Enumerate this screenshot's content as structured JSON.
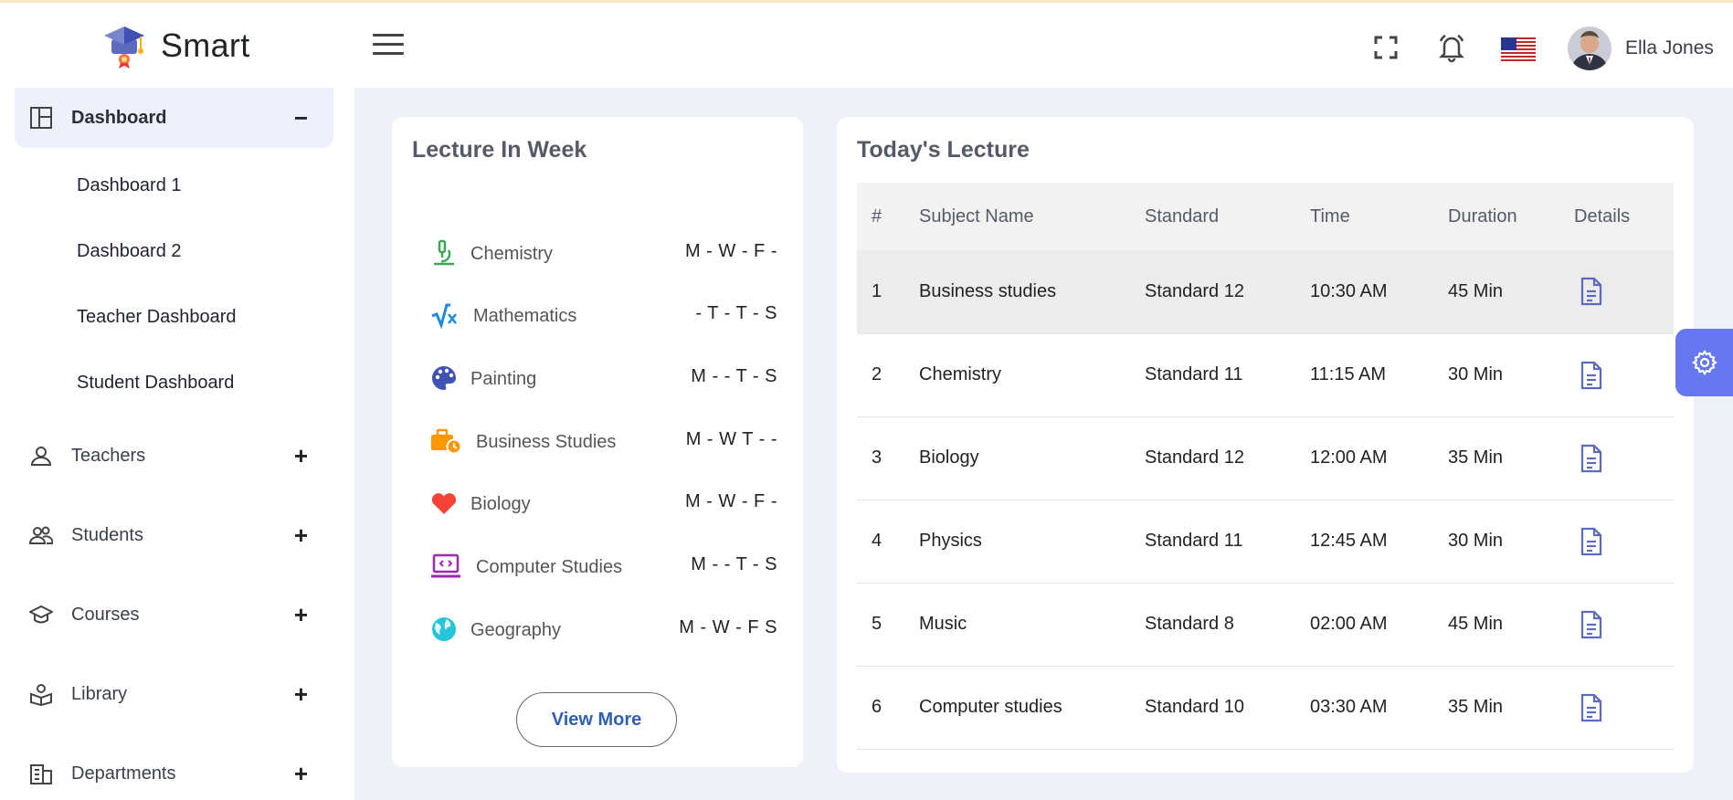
{
  "brand": {
    "name": "Smart"
  },
  "header": {
    "user_name": "Ella Jones"
  },
  "sidebar": {
    "dashboard": {
      "label": "Dashboard",
      "toggle": "−"
    },
    "dashboard_sub": [
      "Dashboard 1",
      "Dashboard 2",
      "Teacher Dashboard",
      "Student Dashboard"
    ],
    "items": [
      {
        "label": "Teachers",
        "toggle": "+"
      },
      {
        "label": "Students",
        "toggle": "+"
      },
      {
        "label": "Courses",
        "toggle": "+"
      },
      {
        "label": "Library",
        "toggle": "+"
      },
      {
        "label": "Departments",
        "toggle": "+"
      }
    ]
  },
  "week": {
    "title": "Lecture In Week",
    "rows": [
      {
        "subject": "Chemistry",
        "days": "M - W - F -",
        "icon": "microscope-icon",
        "color": "#3aa757"
      },
      {
        "subject": "Mathematics",
        "days": "- T - T - S",
        "icon": "square-root-icon",
        "color": "#1e88e5"
      },
      {
        "subject": "Painting",
        "days": "M - - T - S",
        "icon": "palette-icon",
        "color": "#3f51b5"
      },
      {
        "subject": "Business Studies",
        "days": "M - W T - -",
        "icon": "briefcase-clock-icon",
        "color": "#ff9800"
      },
      {
        "subject": "Biology",
        "days": "M - W - F -",
        "icon": "heart-icon",
        "color": "#f44336"
      },
      {
        "subject": "Computer Studies",
        "days": "M - - T - S",
        "icon": "laptop-code-icon",
        "color": "#9c27b0"
      },
      {
        "subject": "Geography",
        "days": "M - W - F S",
        "icon": "globe-icon",
        "color": "#26c6da"
      }
    ],
    "view_more": "View More"
  },
  "today": {
    "title": "Today's Lecture",
    "columns": [
      "#",
      "Subject Name",
      "Standard",
      "Time",
      "Duration",
      "Details"
    ],
    "rows": [
      {
        "no": "1",
        "subject": "Business studies",
        "standard": "Standard 12",
        "time": "10:30 AM",
        "duration": "45 Min"
      },
      {
        "no": "2",
        "subject": "Chemistry",
        "standard": "Standard 11",
        "time": "11:15 AM",
        "duration": "30 Min"
      },
      {
        "no": "3",
        "subject": "Biology",
        "standard": "Standard 12",
        "time": "12:00 AM",
        "duration": "35 Min"
      },
      {
        "no": "4",
        "subject": "Physics",
        "standard": "Standard 11",
        "time": "12:45 AM",
        "duration": "30 Min"
      },
      {
        "no": "5",
        "subject": "Music",
        "standard": "Standard 8",
        "time": "02:00 AM",
        "duration": "45 Min"
      },
      {
        "no": "6",
        "subject": "Computer studies",
        "standard": "Standard 10",
        "time": "03:30 AM",
        "duration": "35 Min"
      }
    ]
  },
  "colors": {
    "accent": "#6777ef",
    "doc_icon": "#5c6bc0",
    "page_bg": "#eef1f8"
  }
}
